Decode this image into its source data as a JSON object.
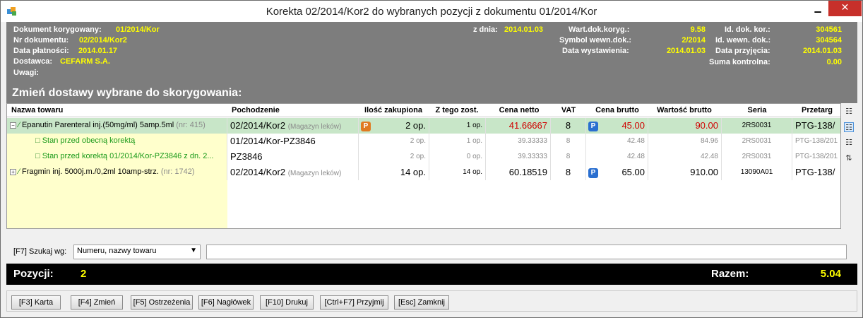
{
  "window": {
    "title": "Korekta 02/2014/Kor2 do wybranych pozycji z dokumentu 01/2014/Kor",
    "minimize": "▁",
    "close": "✕"
  },
  "header": {
    "dok_koryg_label": "Dokument korygowany:",
    "dok_koryg_value": "01/2014/Kor",
    "nr_dok_label": "Nr dokumentu:",
    "nr_dok_value": "02/2014/Kor2",
    "data_platnosci_label": "Data płatności:",
    "data_platnosci_value": "2014.01.17",
    "dostawca_label": "Dostawca:",
    "dostawca_value": "CEFARM S.A.",
    "uwagi_label": "Uwagi:",
    "z_dnia_label": "z dnia:",
    "z_dnia_value": "2014.01.03",
    "wart_label": "Wart.dok.koryg.:",
    "wart_value": "9.58",
    "symbol_label": "Symbol wewn.dok.:",
    "symbol_value": "2/2014",
    "data_wyst_label": "Data wystawienia:",
    "data_wyst_value": "2014.01.03",
    "id_kor_label": "Id. dok. kor.:",
    "id_kor_value": "304561",
    "id_wewn_label": "Id. wewn. dok.:",
    "id_wewn_value": "304564",
    "data_przyj_label": "Data przyjęcia:",
    "data_przyj_value": "2014.01.03",
    "suma_label": "Suma kontrolna:",
    "suma_value": "0.00",
    "heading": "Zmień dostawy wybrane do skorygowania:"
  },
  "grid": {
    "columns": [
      "Nazwa towaru",
      "Pochodzenie",
      "Ilość zakupiona",
      "Z tego zost.",
      "Cena netto",
      "VAT",
      "Cena brutto",
      "Wartość brutto",
      "Seria",
      "Przetarg"
    ],
    "rows": [
      {
        "expander": "−",
        "name": "Epanutin Parenteral inj.(50mg/ml) 5amp.5ml",
        "nr": "(nr: 415)",
        "origin": "02/2014/Kor2",
        "origin_note": "(Magazyn leków)",
        "qty_badge": "P",
        "qty": "2 op.",
        "rest": "1 op.",
        "netto": "41.66667",
        "vat": "8",
        "brutto_badge": "P",
        "brutto": "45.00",
        "wartosc": "90.00",
        "seria": "2RS0031",
        "przetarg": "PTG-138/"
      },
      {
        "name": "Stan przed obecną korektą",
        "origin": "01/2014/Kor-PZ3846",
        "qty": "2 op.",
        "rest": "1 op.",
        "netto": "39.33333",
        "vat": "8",
        "brutto": "42.48",
        "wartosc": "84.96",
        "seria": "2RS0031",
        "przetarg": "PTG-138/201"
      },
      {
        "name": "Stan przed korektą 01/2014/Kor-PZ3846 z dn. 2...",
        "origin": "PZ3846",
        "qty": "2 op.",
        "rest": "0 op.",
        "netto": "39.33333",
        "vat": "8",
        "brutto": "42.48",
        "wartosc": "42.48",
        "seria": "2RS0031",
        "przetarg": "PTG-138/201"
      },
      {
        "expander": "+",
        "name": "Fragmin inj. 5000j.m./0,2ml 10amp-strz.",
        "nr": "(nr: 1742)",
        "origin": "02/2014/Kor2",
        "origin_note": "(Magazyn leków)",
        "qty": "14 op.",
        "rest": "14 op.",
        "netto": "60.18519",
        "vat": "8",
        "brutto_badge": "P",
        "brutto": "65.00",
        "wartosc": "910.00",
        "seria": "13090A01",
        "przetarg": "PTG-138/"
      }
    ]
  },
  "search": {
    "label": "[F7] Szukaj wg:",
    "selected": "Numeru, nazwy towaru",
    "value": ""
  },
  "totals": {
    "pozycji_label": "Pozycji:",
    "pozycji_value": "2",
    "razem_label": "Razem:",
    "razem_value": "5.04"
  },
  "buttons": {
    "karta": "[F3] Karta",
    "zmien": "[F4] Zmień",
    "ostrzezenia": "[F5] Ostrzeżenia",
    "naglowek": "[F6] Nagłówek",
    "drukuj": "[F10] Drukuj",
    "przyjmij": "[Ctrl+F7] Przyjmij",
    "zamknij": "[Esc] Zamknij"
  },
  "colors": {
    "header_bg": "#7d7d7d",
    "value_yellow": "#ffff00",
    "selected_row": "#c8e6c8",
    "name_col_bg": "#ffffcc",
    "red_value": "#d00000",
    "green_text": "#1a9a1a"
  }
}
